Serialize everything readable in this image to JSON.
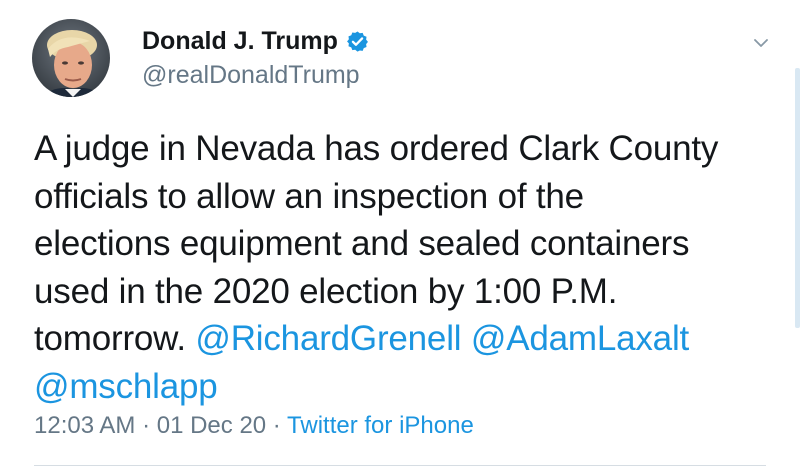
{
  "author": {
    "display_name": "Donald J. Trump",
    "handle": "@realDonaldTrump",
    "verified": true,
    "avatar_icon": "profile-photo"
  },
  "tweet": {
    "lines": [
      "A judge in Nevada has ordered Clark County",
      "officials to allow an inspection of the",
      "elections equipment and sealed containers",
      "used in the 2020 election by 1:00 P.M."
    ],
    "line5_prefix": "tomorrow. ",
    "mentions": [
      "@RichardGrenell",
      "@AdamLaxalt",
      "@mschlapp"
    ],
    "time": "12:03 AM",
    "separator": " · ",
    "date": "01 Dec 20",
    "source": "Twitter for iPhone"
  },
  "colors": {
    "link": "#1b95e0",
    "text": "#14171a",
    "muted": "#657786"
  },
  "icons": {
    "verified": "verified-badge-icon",
    "menu": "chevron-down-icon"
  }
}
